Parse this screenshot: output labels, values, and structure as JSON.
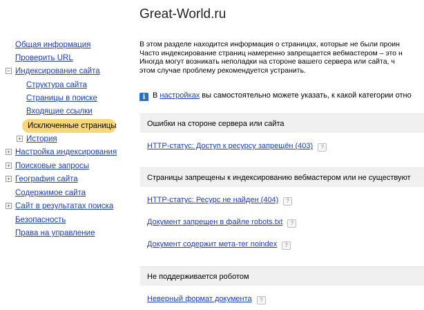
{
  "site_title": "Great-World.ru",
  "sidebar": {
    "items": [
      {
        "label": "Общая информация"
      },
      {
        "label": "Проверить URL"
      },
      {
        "label": "Индексирование сайта",
        "toggle": "−"
      },
      {
        "label": "Структура сайта"
      },
      {
        "label": "Страницы в поиске"
      },
      {
        "label": "Входящие ссылки"
      },
      {
        "label": "Исключенные страницы",
        "active": true
      },
      {
        "label": "История",
        "toggle": "+"
      },
      {
        "label": "Настройка индексирования",
        "toggle": "+"
      },
      {
        "label": "Поисковые запросы",
        "toggle": "+"
      },
      {
        "label": "География сайта",
        "toggle": "+"
      },
      {
        "label": "Содержимое сайта"
      },
      {
        "label": "Сайт в результатах поиска",
        "toggle": "+"
      },
      {
        "label": "Безопасность"
      },
      {
        "label": "Права на управление"
      }
    ]
  },
  "intro": {
    "lines": [
      "В этом разделе находится информация о страницах, которые не были проин",
      "Часто индексирование страниц намеренно запрещается вебмастером – это н",
      "Иногда могут возникать неполадки на стороне вашего сервера или сайта, ч",
      "этом случае проблему рекомендуется устранить."
    ]
  },
  "info": {
    "icon": "info-icon",
    "prefix": "В",
    "link": "настройках",
    "suffix": "вы самостоятельно можете указать, к какой категории отно"
  },
  "help_glyph": "?",
  "groups": [
    {
      "title": "Ошибки на стороне сервера или сайта",
      "items": [
        "HTTP-статус: Доступ к ресурсу запрещён (403)"
      ]
    },
    {
      "title": "Страницы запрещены к индексированию вебмастером или не существуют",
      "items": [
        "HTTP-статус: Ресурс не найден (404)",
        "Документ запрещен в файле robots.txt",
        "Документ содержит мета-тег noindex"
      ]
    },
    {
      "title": "Не поддерживается роботом",
      "items": [
        "Неверный формат документа"
      ]
    }
  ],
  "colors": {
    "link": "#1a3dc1",
    "active_highlight": "#f8d77a",
    "info_icon": "#2a6ebd",
    "group_header_bg": "#f0f0f0"
  }
}
